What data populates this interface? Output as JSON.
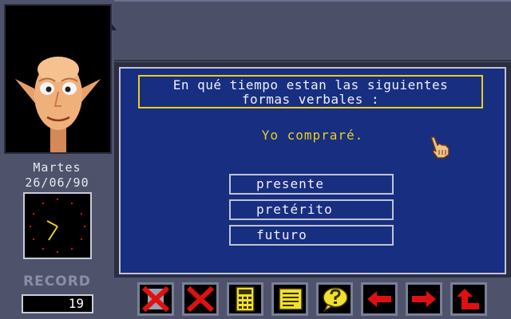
{
  "sidebar": {
    "day": "Martes",
    "date": "26/06/90",
    "record_label": "RECORD",
    "record_value": "19"
  },
  "quiz": {
    "question_line1": "En qué tiempo estan las siguientes",
    "question_line2": "formas verbales :",
    "verb": "Yo compraré.",
    "options": [
      "presente",
      "pretérito",
      "futuro"
    ]
  },
  "toolbar": {
    "buttons": [
      {
        "icon": "cross-icon-1"
      },
      {
        "icon": "cross-icon-2"
      },
      {
        "icon": "calculator-icon"
      },
      {
        "icon": "notepad-icon"
      },
      {
        "icon": "help-icon"
      },
      {
        "icon": "arrow-left-icon"
      },
      {
        "icon": "arrow-right-icon"
      },
      {
        "icon": "return-icon"
      }
    ]
  },
  "colors": {
    "panel_blue": "#182e80",
    "text_yellow": "#e8d020",
    "icon_red": "#e01010",
    "icon_yellow": "#f0e030"
  }
}
